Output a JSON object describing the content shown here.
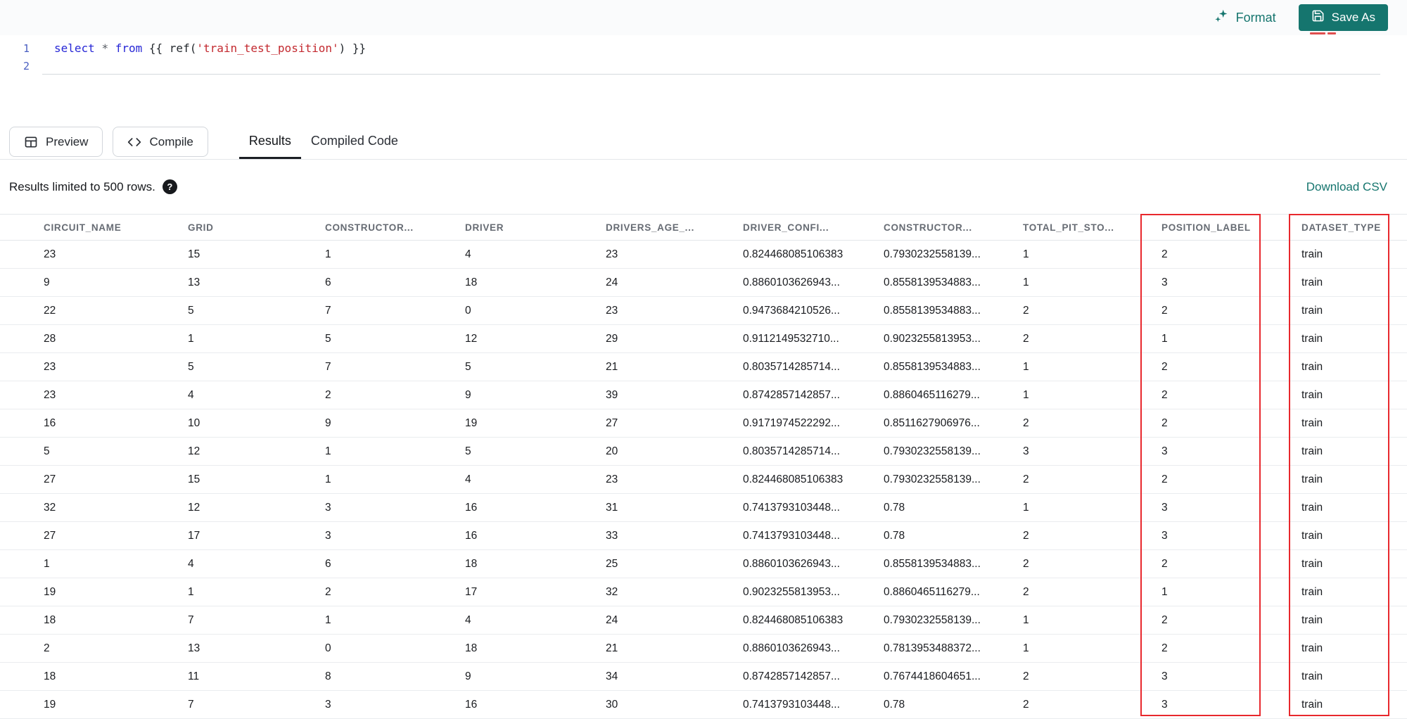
{
  "colors": {
    "accent_teal": "#15756e",
    "highlight_red": "#e8282d"
  },
  "topbar": {
    "format_label": "Format",
    "save_as_label": "Save As"
  },
  "editor": {
    "line_numbers": [
      "1",
      "2"
    ],
    "code_line_1": "select * from {{ ref('train_test_position') }}",
    "tokens": [
      {
        "t": "select",
        "c": "kw"
      },
      {
        "t": " ",
        "c": "pl"
      },
      {
        "t": "*",
        "c": "op"
      },
      {
        "t": " ",
        "c": "pl"
      },
      {
        "t": "from",
        "c": "kw"
      },
      {
        "t": " ",
        "c": "pl"
      },
      {
        "t": "{{ ",
        "c": "br"
      },
      {
        "t": "ref(",
        "c": "fn"
      },
      {
        "t": "'train_test_position'",
        "c": "str"
      },
      {
        "t": ")",
        "c": "fn"
      },
      {
        "t": " }}",
        "c": "br"
      }
    ]
  },
  "toolbar": {
    "preview_label": "Preview",
    "compile_label": "Compile",
    "tabs": [
      {
        "label": "Results",
        "active": true
      },
      {
        "label": "Compiled Code",
        "active": false
      }
    ]
  },
  "results": {
    "limit_text": "Results limited to 500 rows.",
    "help_icon": "?",
    "download_label": "Download CSV"
  },
  "table": {
    "columns": [
      "CIRCUIT_NAME",
      "GRID",
      "CONSTRUCTOR...",
      "DRIVER",
      "DRIVERS_AGE_...",
      "DRIVER_CONFI...",
      "CONSTRUCTOR...",
      "TOTAL_PIT_STO...",
      "POSITION_LABEL",
      "DATASET_TYPE"
    ],
    "rows": [
      [
        "23",
        "15",
        "1",
        "4",
        "23",
        "0.824468085106383",
        "0.7930232558139...",
        "1",
        "2",
        "train"
      ],
      [
        "9",
        "13",
        "6",
        "18",
        "24",
        "0.8860103626943...",
        "0.8558139534883...",
        "1",
        "3",
        "train"
      ],
      [
        "22",
        "5",
        "7",
        "0",
        "23",
        "0.9473684210526...",
        "0.8558139534883...",
        "2",
        "2",
        "train"
      ],
      [
        "28",
        "1",
        "5",
        "12",
        "29",
        "0.9112149532710...",
        "0.9023255813953...",
        "2",
        "1",
        "train"
      ],
      [
        "23",
        "5",
        "7",
        "5",
        "21",
        "0.8035714285714...",
        "0.8558139534883...",
        "1",
        "2",
        "train"
      ],
      [
        "23",
        "4",
        "2",
        "9",
        "39",
        "0.8742857142857...",
        "0.8860465116279...",
        "1",
        "2",
        "train"
      ],
      [
        "16",
        "10",
        "9",
        "19",
        "27",
        "0.9171974522292...",
        "0.8511627906976...",
        "2",
        "2",
        "train"
      ],
      [
        "5",
        "12",
        "1",
        "5",
        "20",
        "0.8035714285714...",
        "0.7930232558139...",
        "3",
        "3",
        "train"
      ],
      [
        "27",
        "15",
        "1",
        "4",
        "23",
        "0.824468085106383",
        "0.7930232558139...",
        "2",
        "2",
        "train"
      ],
      [
        "32",
        "12",
        "3",
        "16",
        "31",
        "0.7413793103448...",
        "0.78",
        "1",
        "3",
        "train"
      ],
      [
        "27",
        "17",
        "3",
        "16",
        "33",
        "0.7413793103448...",
        "0.78",
        "2",
        "3",
        "train"
      ],
      [
        "1",
        "4",
        "6",
        "18",
        "25",
        "0.8860103626943...",
        "0.8558139534883...",
        "2",
        "2",
        "train"
      ],
      [
        "19",
        "1",
        "2",
        "17",
        "32",
        "0.9023255813953...",
        "0.8860465116279...",
        "2",
        "1",
        "train"
      ],
      [
        "18",
        "7",
        "1",
        "4",
        "24",
        "0.824468085106383",
        "0.7930232558139...",
        "1",
        "2",
        "train"
      ],
      [
        "2",
        "13",
        "0",
        "18",
        "21",
        "0.8860103626943...",
        "0.7813953488372...",
        "1",
        "2",
        "train"
      ],
      [
        "18",
        "11",
        "8",
        "9",
        "34",
        "0.8742857142857...",
        "0.7674418604651...",
        "2",
        "3",
        "train"
      ],
      [
        "19",
        "7",
        "3",
        "16",
        "30",
        "0.7413793103448...",
        "0.78",
        "2",
        "3",
        "train"
      ]
    ]
  }
}
